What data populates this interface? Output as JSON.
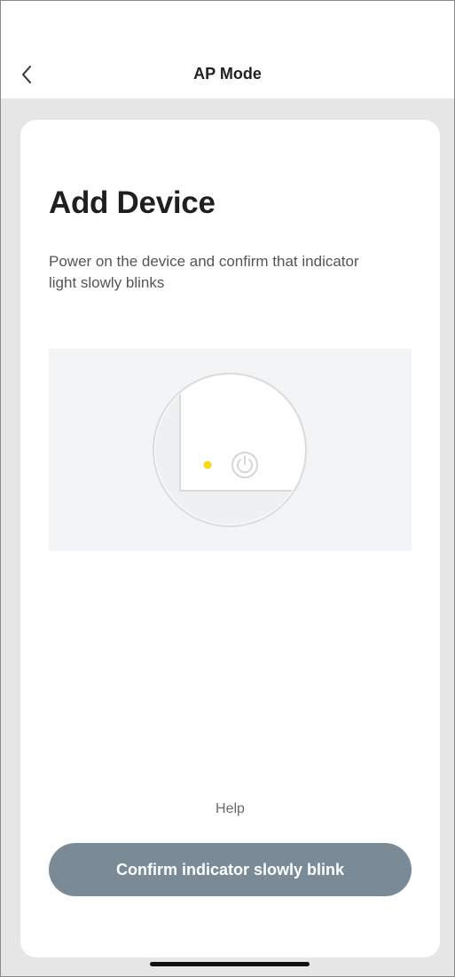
{
  "header": {
    "back_icon": "chevron-left-icon",
    "title": "AP Mode"
  },
  "main": {
    "heading": "Add Device",
    "description": "Power on the device and confirm that indicator light slowly blinks",
    "illustration": {
      "indicator_color": "#f5d90a",
      "icon": "power-icon"
    },
    "help_label": "Help",
    "confirm_button_label": "Confirm indicator slowly blink"
  },
  "colors": {
    "button": "#7a8a96",
    "background": "#e6e6e6",
    "card": "#ffffff"
  }
}
